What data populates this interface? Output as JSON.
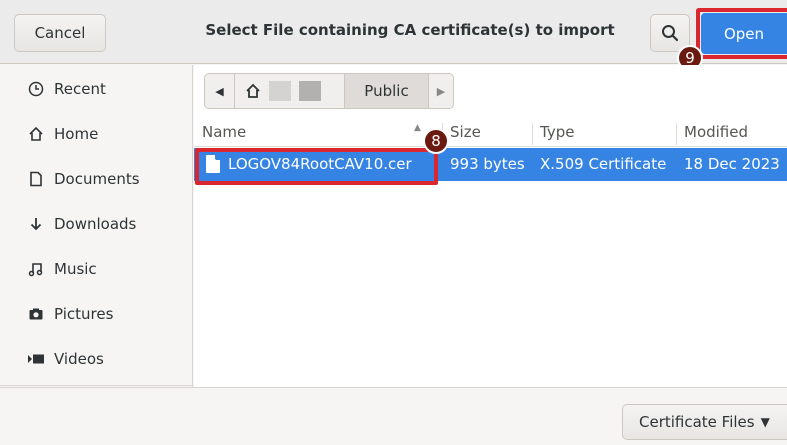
{
  "dialog": {
    "title": "Select File containing CA certificate(s) to import",
    "cancel_label": "Cancel",
    "open_label": "Open",
    "search_icon": "🔍"
  },
  "annotations": {
    "step_open": "9",
    "step_file": "8"
  },
  "sidebar": {
    "items": [
      {
        "label": "Recent",
        "icon": "clock-icon",
        "glyph": "◷"
      },
      {
        "label": "Home",
        "icon": "home-icon",
        "glyph": "⌂"
      },
      {
        "label": "Documents",
        "icon": "document-icon",
        "glyph": "▯"
      },
      {
        "label": "Downloads",
        "icon": "download-icon",
        "glyph": "↓"
      },
      {
        "label": "Music",
        "icon": "music-icon",
        "glyph": "♫"
      },
      {
        "label": "Pictures",
        "icon": "camera-icon",
        "glyph": "◘"
      },
      {
        "label": "Videos",
        "icon": "video-icon",
        "glyph": "▸"
      }
    ]
  },
  "pathbar": {
    "current": "Public",
    "back_glyph": "◀",
    "forward_glyph": "▶",
    "home_glyph": "⌂"
  },
  "columns": {
    "name": "Name",
    "size": "Size",
    "type": "Type",
    "modified": "Modified"
  },
  "files": [
    {
      "name": "LOGOV84RootCAV10.cer",
      "size": "993 bytes",
      "type": "X.509 Certificate",
      "modified": "18 Dec 2023"
    }
  ],
  "filter": {
    "label": "Certificate Files",
    "caret": "▼"
  },
  "colors": {
    "accent": "#3584e4",
    "highlight_border": "#d9262f",
    "badge": "#6b1a10"
  }
}
